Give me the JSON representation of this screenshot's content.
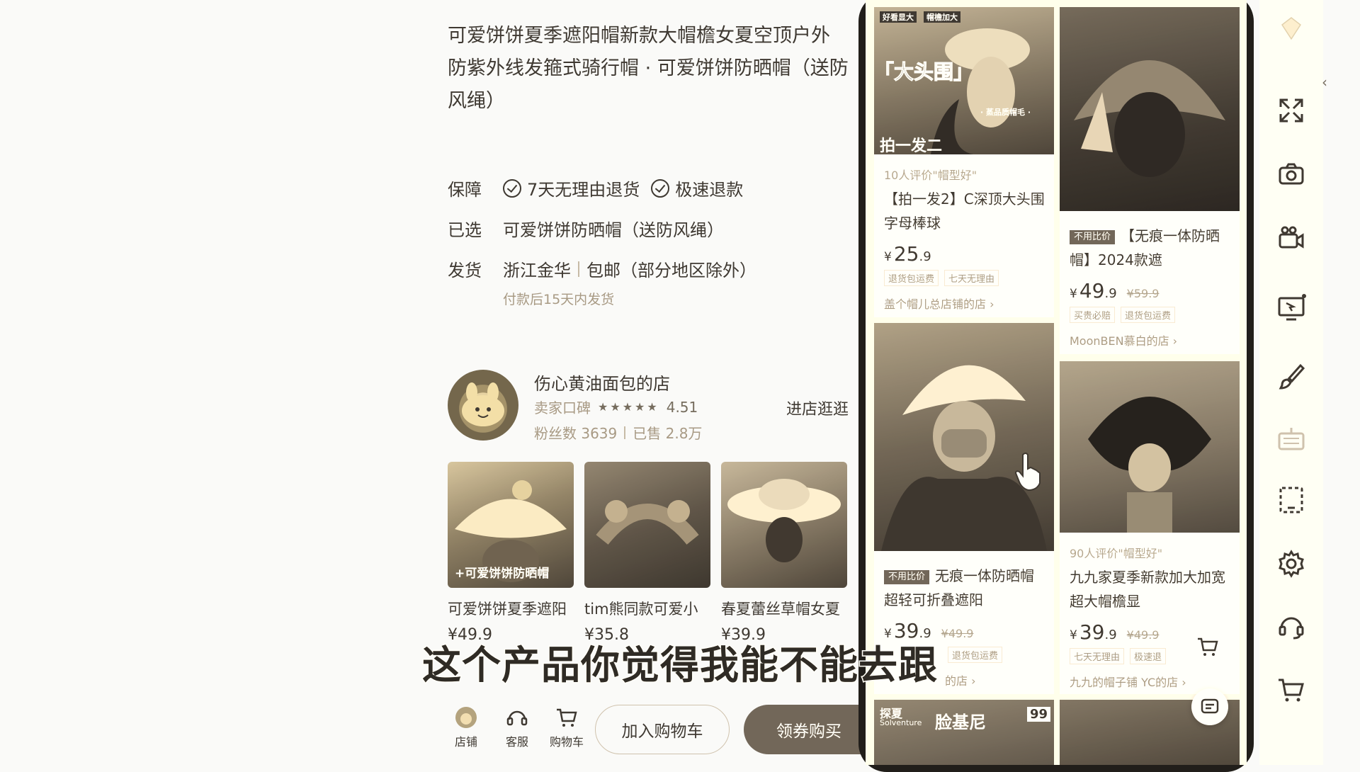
{
  "product": {
    "title_lines": [
      "可爱饼饼夏季遮阳帽新款大帽檐女夏空顶户外",
      "防紫外线发箍式骑行帽 · 可爱饼饼防晒帽（送防",
      "风绳）"
    ],
    "guarantee_label": "保障",
    "guarantee_1": "7天无理由退货",
    "guarantee_2": "极速退款",
    "selected_label": "已选",
    "selected_value": "可爱饼饼防晒帽（送防风绳）",
    "ship_label": "发货",
    "ship_from": "浙江金华",
    "ship_free": "包邮（部分地区除外）",
    "ship_note": "付款后15天内发货"
  },
  "shop": {
    "name": "伤心黄油面包的店",
    "rating_label": "卖家口碑",
    "stars": "★★★★★",
    "rating": "4.51",
    "fans": "粉丝数 3639",
    "sold": "已售 2.8万",
    "enter": "进店逛逛"
  },
  "recommend": [
    {
      "title": "可爱饼饼夏季遮阳",
      "price": "¥49.9",
      "img_text": "+可爱饼饼防晒帽"
    },
    {
      "title": "tim熊同款可爱小",
      "price": "¥35.8"
    },
    {
      "title": "春夏蕾丝草帽女夏",
      "price": "¥39.9"
    }
  ],
  "bottom": {
    "store": "店铺",
    "service": "客服",
    "cart": "购物车",
    "add_cart": "加入购物车",
    "buy": "领券购买"
  },
  "subtitle": "这个产品你觉得我能不能去跟",
  "feed": {
    "c1": {
      "img_tags": [
        "好看显大",
        "帽檐加大"
      ],
      "img_big": "「大头围」",
      "img_small": "· 蒸品质帽毛 ·",
      "img_bottom": "拍一发二",
      "eval": "10人评价\"帽型好\"",
      "title": "【拍一发2】C深顶大头围字母棒球",
      "price_int": "25",
      "price_dec": ".9",
      "badges": [
        "退货包运费",
        "七天无理由"
      ],
      "shop": "盖个帽儿总店铺的店 ›"
    },
    "c2": {
      "tag": "不用比价",
      "title": "【无痕一体防晒帽】2024款遮",
      "price_int": "49",
      "price_dec": ".9",
      "orig": "¥59.9",
      "badges": [
        "买贵必赔",
        "退货包运费"
      ],
      "shop": "MoonBEN慕白的店 ›"
    },
    "c3": {
      "tag": "不用比价",
      "title": "无痕一体防晒帽超轻可折叠遮阳",
      "price_int": "39",
      "price_dec": ".9",
      "orig": "¥49.9",
      "badges": [
        "退货包运费"
      ],
      "shop": "的店 ›"
    },
    "c4": {
      "eval": "90人评价\"帽型好\"",
      "title": "九九家夏季新款加大加宽超大帽檐显",
      "price_int": "39",
      "price_dec": ".9",
      "orig": "¥49.9",
      "badges": [
        "七天无理由",
        "极速退"
      ],
      "shop": "九九的帽子铺 YC的店 ›"
    },
    "c5": {
      "brand": "Solventure",
      "brand_cn": "探夏",
      "label": "脸基尼",
      "price_badge": "99"
    },
    "yen": "¥"
  }
}
